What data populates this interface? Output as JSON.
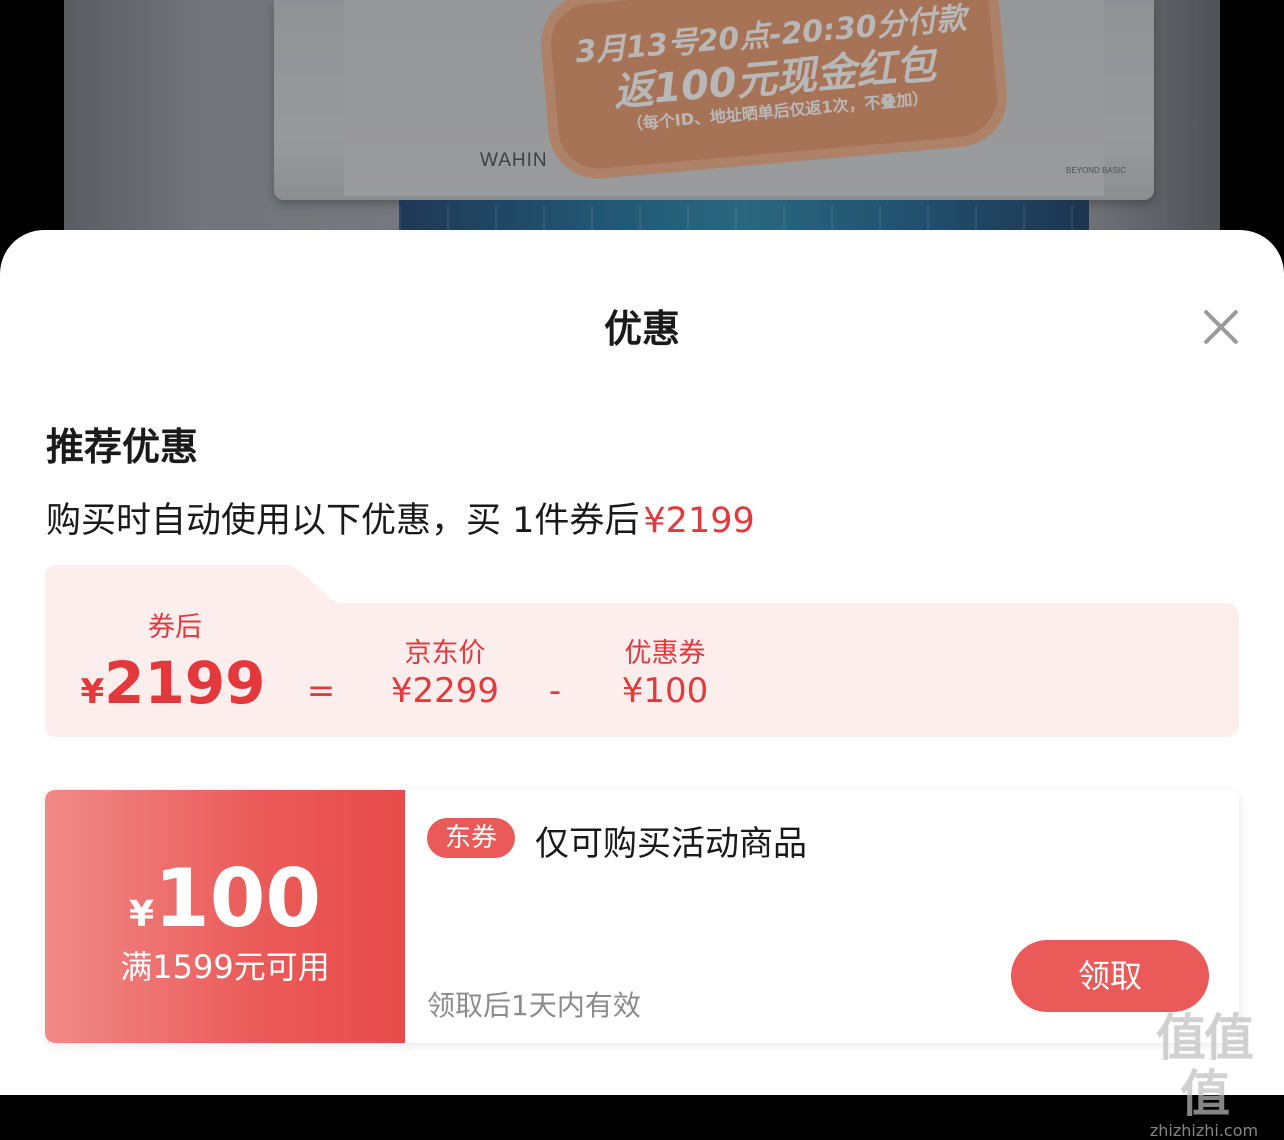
{
  "product_image": {
    "promo_line1": "3月13号20点-20:30分付款",
    "promo_line2": "返100元现金红包",
    "promo_line3": "（每个ID、地址晒单后仅返1次，不叠加）",
    "brand": "WAHIN",
    "model": "BEYOND BASIC"
  },
  "sheet": {
    "title": "优惠",
    "close_icon": "close-icon"
  },
  "recommended": {
    "heading": "推荐优惠",
    "summary_text": "购买时自动使用以下优惠，买 1件券后",
    "summary_price": "¥2199"
  },
  "breakdown": {
    "after_coupon_label": "券后",
    "after_coupon_yen": "¥",
    "after_coupon_value": "2199",
    "equals": "=",
    "jd_price_label": "京东价",
    "jd_price_value": "¥2299",
    "minus": "-",
    "coupon_label": "优惠券",
    "coupon_value": "¥100"
  },
  "coupon": {
    "yen": "¥",
    "amount": "100",
    "condition": "满1599元可用",
    "tag": "东券",
    "description": "仅可购买活动商品",
    "validity": "领取后1天内有效",
    "claim_label": "领取"
  },
  "watermark": {
    "logo": "值值值",
    "url": "zhizhizhi.com"
  },
  "colors": {
    "accent_red": "#e4393c",
    "coupon_red": "#ea5a58",
    "breakdown_bg": "#fdeeee"
  }
}
